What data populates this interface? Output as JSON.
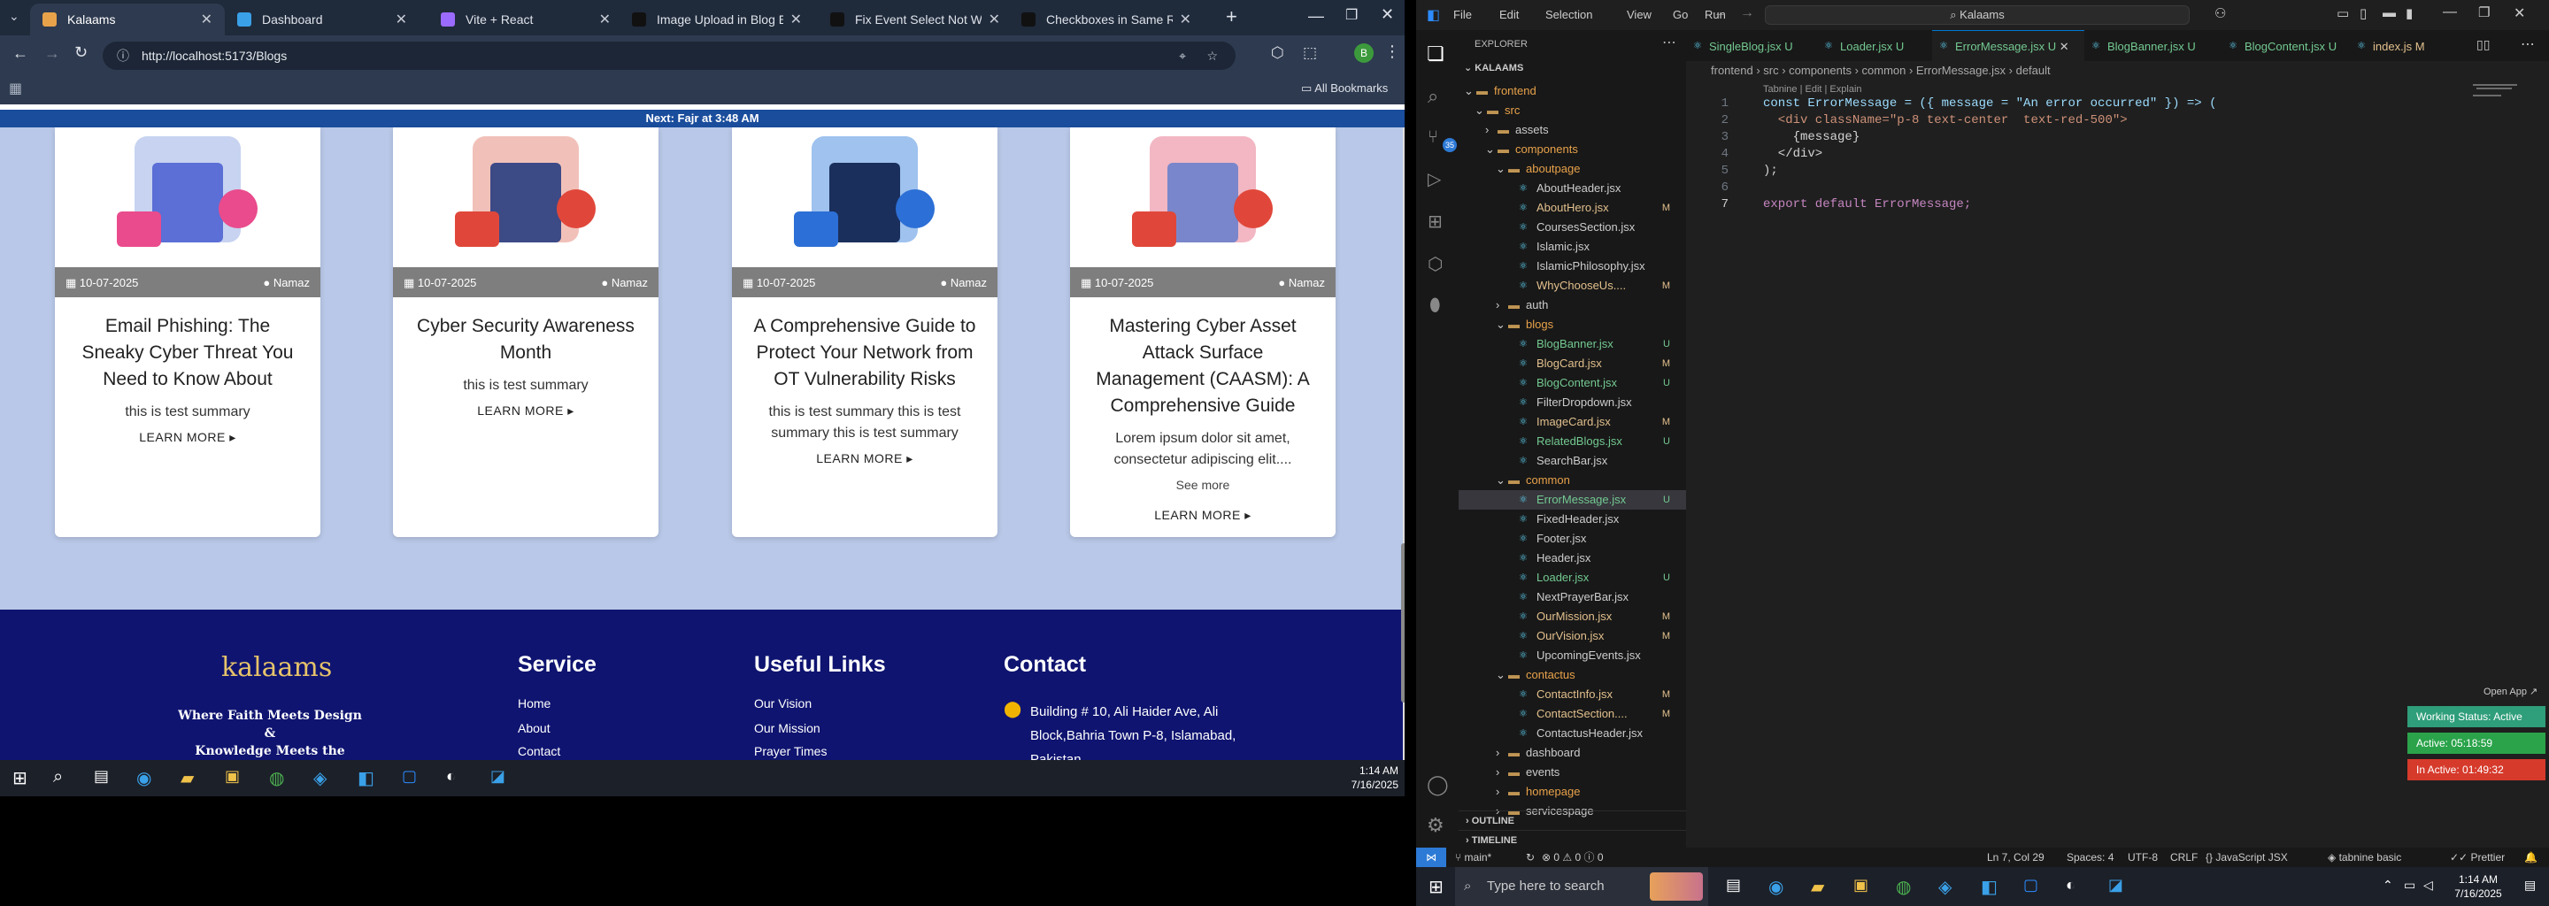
{
  "browser": {
    "tabs": [
      {
        "title": "Kalaams",
        "active": true
      },
      {
        "title": "Dashboard",
        "active": false
      },
      {
        "title": "Vite + React",
        "active": false
      },
      {
        "title": "Image Upload in Blog Editor",
        "active": false
      },
      {
        "title": "Fix Event Select Not Working",
        "active": false
      },
      {
        "title": "Checkboxes in Same Row",
        "active": false
      }
    ],
    "url": "http://localhost:5173/Blogs",
    "bookmarks_label": "All Bookmarks",
    "notice": "Next: Fajr at 3:48 AM"
  },
  "blogs": [
    {
      "date": "10-07-2025",
      "author": "Namaz",
      "title": "Email Phishing: The Sneaky Cyber Threat You Need to Know About",
      "summary": "this is test summary",
      "see_more": "",
      "more": "LEARN MORE ▸"
    },
    {
      "date": "10-07-2025",
      "author": "Namaz",
      "title": "Cyber Security Awareness Month",
      "summary": "this is test summary",
      "see_more": "",
      "more": "LEARN MORE ▸"
    },
    {
      "date": "10-07-2025",
      "author": "Namaz",
      "title": "A Comprehensive Guide to Protect Your Network from OT Vulnerability Risks",
      "summary": "this is test summary this is test summary this is test summary",
      "see_more": "",
      "more": "LEARN MORE ▸"
    },
    {
      "date": "10-07-2025",
      "author": "Namaz",
      "title": "Mastering Cyber Asset Attack Surface Management (CAASM): A Comprehensive Guide",
      "summary": "Lorem ipsum dolor sit amet, consectetur adipiscing elit....",
      "see_more": "See more",
      "more": "LEARN MORE ▸"
    }
  ],
  "footer": {
    "logo": "kalaams",
    "tagline1": "Where Faith Meets Design",
    "tagline2": "&",
    "tagline3": "Knowledge Meets the Heart",
    "service_title": "Service",
    "service_links": [
      "Home",
      "About",
      "Contact"
    ],
    "useful_title": "Useful Links",
    "useful_links": [
      "Our Vision",
      "Our Mission",
      "Prayer Times"
    ],
    "contact_title": "Contact",
    "address": "Building # 10, Ali Haider Ave, Ali Block,Bahria Town P-8, Islamabad, Pakistan"
  },
  "taskbar_left": {
    "time": "1:14 AM",
    "date": "7/16/2025"
  },
  "vscode": {
    "menu": [
      "File",
      "Edit",
      "Selection",
      "View",
      "Go",
      "Run"
    ],
    "search": "Kalaams",
    "explorer_title": "EXPLORER",
    "workspace": "KALAAMS",
    "tree": [
      {
        "name": "frontend",
        "type": "folder",
        "open": true,
        "indent": 1,
        "status": "",
        "color": "#e8a24a"
      },
      {
        "name": "src",
        "type": "folder",
        "open": true,
        "indent": 2,
        "status": "",
        "color": "#e8a24a"
      },
      {
        "name": "assets",
        "type": "folder",
        "open": false,
        "indent": 3,
        "status": "",
        "color": "#ccc"
      },
      {
        "name": "components",
        "type": "folder",
        "open": true,
        "indent": 3,
        "status": "",
        "color": "#e8a24a"
      },
      {
        "name": "aboutpage",
        "type": "folder",
        "open": true,
        "indent": 4,
        "status": "",
        "color": "#e8a24a"
      },
      {
        "name": "AboutHeader.jsx",
        "type": "file",
        "indent": 5,
        "status": "",
        "color": "#ccc"
      },
      {
        "name": "AboutHero.jsx",
        "type": "file",
        "indent": 5,
        "status": "M",
        "color": "#e2c08d"
      },
      {
        "name": "CoursesSection.jsx",
        "type": "file",
        "indent": 5,
        "status": "",
        "color": "#ccc"
      },
      {
        "name": "Islamic.jsx",
        "type": "file",
        "indent": 5,
        "status": "",
        "color": "#ccc"
      },
      {
        "name": "IslamicPhilosophy.jsx",
        "type": "file",
        "indent": 5,
        "status": "",
        "color": "#ccc"
      },
      {
        "name": "WhyChooseUs....",
        "type": "file",
        "indent": 5,
        "status": "M",
        "color": "#e2c08d"
      },
      {
        "name": "auth",
        "type": "folder",
        "open": false,
        "indent": 4,
        "status": "",
        "color": "#ccc"
      },
      {
        "name": "blogs",
        "type": "folder",
        "open": true,
        "indent": 4,
        "status": "",
        "color": "#e8a24a"
      },
      {
        "name": "BlogBanner.jsx",
        "type": "file",
        "indent": 5,
        "status": "U",
        "color": "#73c991"
      },
      {
        "name": "BlogCard.jsx",
        "type": "file",
        "indent": 5,
        "status": "M",
        "color": "#e2c08d"
      },
      {
        "name": "BlogContent.jsx",
        "type": "file",
        "indent": 5,
        "status": "U",
        "color": "#73c991"
      },
      {
        "name": "FilterDropdown.jsx",
        "type": "file",
        "indent": 5,
        "status": "",
        "color": "#ccc"
      },
      {
        "name": "ImageCard.jsx",
        "type": "file",
        "indent": 5,
        "status": "M",
        "color": "#e2c08d"
      },
      {
        "name": "RelatedBlogs.jsx",
        "type": "file",
        "indent": 5,
        "status": "U",
        "color": "#73c991"
      },
      {
        "name": "SearchBar.jsx",
        "type": "file",
        "indent": 5,
        "status": "",
        "color": "#ccc"
      },
      {
        "name": "common",
        "type": "folder",
        "open": true,
        "indent": 4,
        "status": "",
        "color": "#e8a24a"
      },
      {
        "name": "ErrorMessage.jsx",
        "type": "file",
        "indent": 5,
        "status": "U",
        "color": "#73c991",
        "selected": true
      },
      {
        "name": "FixedHeader.jsx",
        "type": "file",
        "indent": 5,
        "status": "",
        "color": "#ccc"
      },
      {
        "name": "Footer.jsx",
        "type": "file",
        "indent": 5,
        "status": "",
        "color": "#ccc"
      },
      {
        "name": "Header.jsx",
        "type": "file",
        "indent": 5,
        "status": "",
        "color": "#ccc"
      },
      {
        "name": "Loader.jsx",
        "type": "file",
        "indent": 5,
        "status": "U",
        "color": "#73c991"
      },
      {
        "name": "NextPrayerBar.jsx",
        "type": "file",
        "indent": 5,
        "status": "",
        "color": "#ccc"
      },
      {
        "name": "OurMission.jsx",
        "type": "file",
        "indent": 5,
        "status": "M",
        "color": "#e2c08d"
      },
      {
        "name": "OurVision.jsx",
        "type": "file",
        "indent": 5,
        "status": "M",
        "color": "#e2c08d"
      },
      {
        "name": "UpcomingEvents.jsx",
        "type": "file",
        "indent": 5,
        "status": "",
        "color": "#ccc"
      },
      {
        "name": "contactus",
        "type": "folder",
        "open": true,
        "indent": 4,
        "status": "",
        "color": "#e8a24a"
      },
      {
        "name": "ContactInfo.jsx",
        "type": "file",
        "indent": 5,
        "status": "M",
        "color": "#e2c08d"
      },
      {
        "name": "ContactSection....",
        "type": "file",
        "indent": 5,
        "status": "M",
        "color": "#e2c08d"
      },
      {
        "name": "ContactusHeader.jsx",
        "type": "file",
        "indent": 5,
        "status": "",
        "color": "#ccc"
      },
      {
        "name": "dashboard",
        "type": "folder",
        "open": false,
        "indent": 4,
        "status": "",
        "color": "#ccc"
      },
      {
        "name": "events",
        "type": "folder",
        "open": false,
        "indent": 4,
        "status": "",
        "color": "#ccc"
      },
      {
        "name": "homepage",
        "type": "folder",
        "open": false,
        "indent": 4,
        "status": "",
        "color": "#e8a24a"
      },
      {
        "name": "servicespage",
        "type": "folder",
        "open": false,
        "indent": 4,
        "status": "",
        "color": "#ccc"
      }
    ],
    "outline": "OUTLINE",
    "timeline": "TIMELINE",
    "editor_tabs": [
      {
        "name": "SingleBlog.jsx",
        "status": "U",
        "active": false
      },
      {
        "name": "Loader.jsx",
        "status": "U",
        "active": false
      },
      {
        "name": "ErrorMessage.jsx",
        "status": "U",
        "active": true
      },
      {
        "name": "BlogBanner.jsx",
        "status": "U",
        "active": false
      },
      {
        "name": "BlogContent.jsx",
        "status": "U",
        "active": false
      },
      {
        "name": "index.js",
        "status": "M",
        "active": false
      }
    ],
    "breadcrumb": "frontend › src › components › common › ErrorMessage.jsx › default",
    "codelens": "Tabnine | Edit | Explain",
    "code_lines": [
      "const ErrorMessage = ({ message = \"An error occurred\" }) => (",
      "  <div className=\"p-8 text-center  text-red-500\">",
      "    {message}",
      "  </div>",
      ");",
      "",
      "export default ErrorMessage;"
    ],
    "open_app": "Open App ↗",
    "badges": [
      {
        "text": "Working Status: Active",
        "color": "#2f9e7a"
      },
      {
        "text": "Active: 05:18:59",
        "color": "#2aa34a"
      },
      {
        "text": "In Active: 01:49:32",
        "color": "#d63a2b"
      }
    ],
    "status": {
      "branch": "main*",
      "problems": "⊗ 0 ⚠ 0 ⓘ 0",
      "position": "Ln 7, Col 29",
      "spaces": "Spaces: 4",
      "encoding": "UTF-8",
      "eol": "CRLF",
      "language": "{} JavaScript JSX",
      "tabnine": "tabnine basic",
      "prettier": "Prettier"
    },
    "taskbar_search": "Type here to search",
    "time": "1:14 AM",
    "date": "7/16/2025"
  }
}
